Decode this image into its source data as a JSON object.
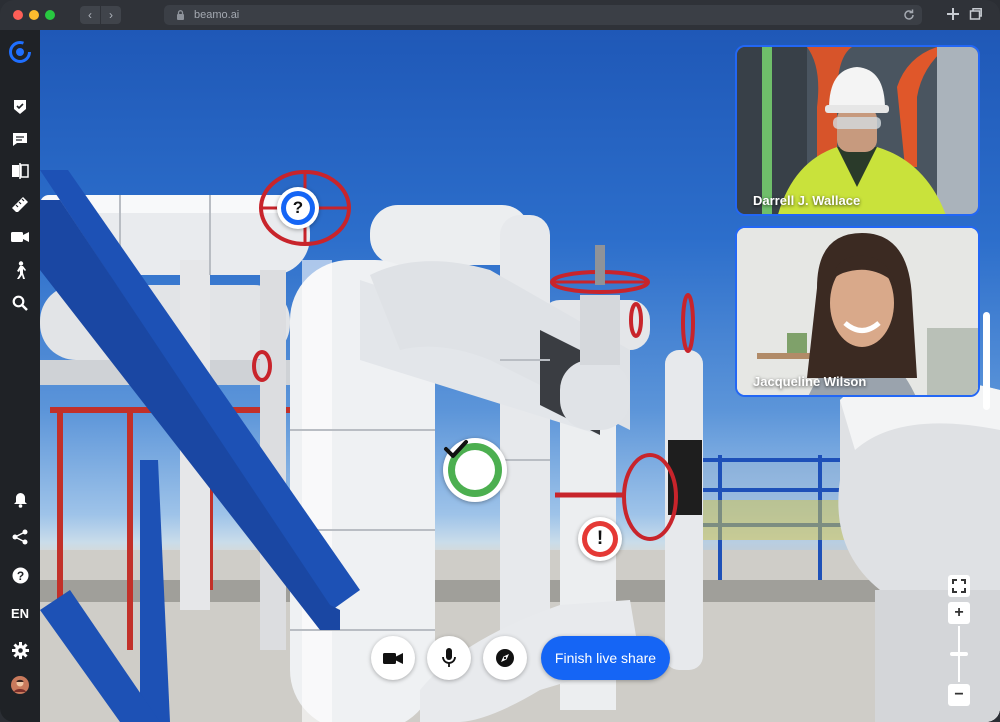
{
  "browser": {
    "url": "beamo.ai",
    "icons": [
      "back-arrow",
      "forward-arrow",
      "lock-icon",
      "reload-icon",
      "new-tab-plus",
      "tabs-overview"
    ]
  },
  "sidebar": {
    "items": [
      {
        "name": "checklist-icon"
      },
      {
        "name": "chat-icon"
      },
      {
        "name": "compare-icon"
      },
      {
        "name": "measure-icon"
      },
      {
        "name": "video-camera-icon"
      },
      {
        "name": "walk-icon"
      },
      {
        "name": "search-icon"
      }
    ],
    "bottom": {
      "language": "EN",
      "icons": [
        "bell-icon",
        "share-icon",
        "help-icon",
        "settings-icon",
        "avatar"
      ]
    }
  },
  "markers": [
    {
      "type": "question",
      "symbol": "?",
      "color": "#1565f5"
    },
    {
      "type": "check",
      "color": "#4caf50"
    },
    {
      "type": "warning",
      "symbol": "!",
      "color": "#e53935"
    }
  ],
  "participants": [
    {
      "name": "Darrell J. Wallace"
    },
    {
      "name": "Jacqueline Wilson"
    }
  ],
  "controls": {
    "camera": "video-camera-icon",
    "mic": "microphone-icon",
    "compass": "compass-icon",
    "finish_label": "Finish live share"
  },
  "zoom": {
    "plus": "+",
    "minus": "−"
  },
  "colors": {
    "accent": "#1565f5",
    "sidebar": "#1f2226",
    "chrome": "#2f3238"
  }
}
